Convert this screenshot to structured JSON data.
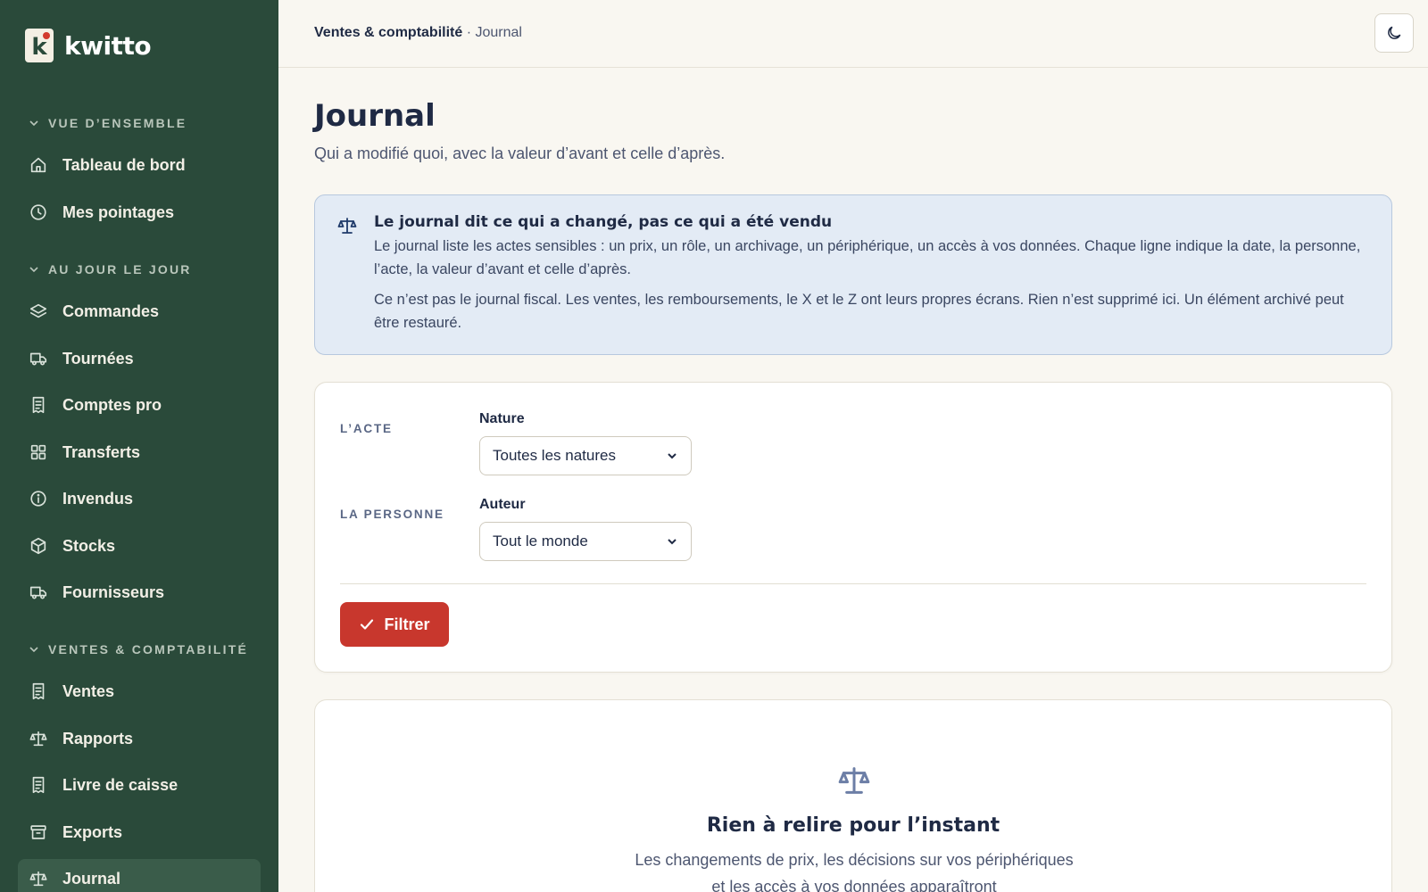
{
  "brand": {
    "name": "kwitto",
    "logo_letter": "k"
  },
  "sidebar": {
    "groups": [
      {
        "title": "VUE D’ENSEMBLE",
        "items": [
          {
            "label": "Tableau de bord",
            "icon": "home-icon"
          },
          {
            "label": "Mes pointages",
            "icon": "clock-icon"
          }
        ]
      },
      {
        "title": "AU JOUR LE JOUR",
        "items": [
          {
            "label": "Commandes",
            "icon": "layers-icon"
          },
          {
            "label": "Tournées",
            "icon": "truck-icon"
          },
          {
            "label": "Comptes pro",
            "icon": "receipt-icon"
          },
          {
            "label": "Transferts",
            "icon": "grid-icon"
          },
          {
            "label": "Invendus",
            "icon": "info-icon"
          },
          {
            "label": "Stocks",
            "icon": "box-icon"
          },
          {
            "label": "Fournisseurs",
            "icon": "truck-icon"
          }
        ]
      },
      {
        "title": "VENTES & COMPTABILITÉ",
        "items": [
          {
            "label": "Ventes",
            "icon": "receipt-icon"
          },
          {
            "label": "Rapports",
            "icon": "scale-icon"
          },
          {
            "label": "Livre de caisse",
            "icon": "receipt-icon"
          },
          {
            "label": "Exports",
            "icon": "archive-icon"
          },
          {
            "label": "Journal",
            "icon": "scale-icon",
            "active": true
          }
        ]
      }
    ]
  },
  "header": {
    "breadcrumb_root": "Ventes & comptabilité",
    "breadcrumb_sep": "·",
    "breadcrumb_current": "Journal",
    "theme_toggle_icon": "moon-icon"
  },
  "main": {
    "title": "Journal",
    "subtitle": "Qui a modifié quoi, avec la valeur d’avant et celle d’après.",
    "info": {
      "title": "Le journal dit ce qui a changé, pas ce qui a été vendu",
      "p1": "Le journal liste les actes sensibles : un prix, un rôle, un archivage, un périphérique, un accès à vos données. Chaque ligne indique la date, la personne, l’acte, la valeur d’avant et celle d’après.",
      "p2": "Ce n’est pas le journal fiscal. Les ventes, les remboursements, le X et le Z ont leurs propres écrans. Rien n’est supprimé ici. Un élément archivé peut être restauré."
    },
    "filters": {
      "section_act": "L’ACTE",
      "nature_label": "Nature",
      "nature_value": "Toutes les natures",
      "section_person": "LA PERSONNE",
      "author_label": "Auteur",
      "author_value": "Tout le monde",
      "submit_label": "Filtrer"
    },
    "empty": {
      "title": "Rien à relire pour l’instant",
      "text": "Les changements de prix, les décisions sur vos périphériques et les accès à vos données apparaîtront"
    }
  },
  "colors": {
    "sidebar_bg": "#2a4a3a",
    "accent_red": "#c8372d",
    "info_bg": "#e3ebf5",
    "page_bg": "#f9f7f1"
  }
}
